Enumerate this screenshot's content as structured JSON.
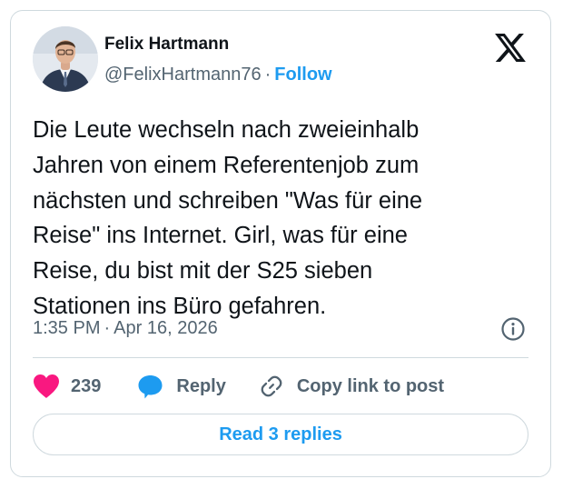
{
  "author": {
    "name": "Felix Hartmann",
    "handle": "@FelixHartmann76",
    "separator": "·",
    "follow_label": "Follow"
  },
  "tweet": {
    "text": "Die Leute wechseln nach zweieinhalb\nJahren von einem Referentenjob zum\nnächsten und schreiben \"Was für eine\nReise\" ins Internet. Girl, was für eine\nReise, du bist mit der S25 sieben\nStationen ins Büro gefahren.",
    "time": "1:35 PM",
    "separator": "·",
    "date": "Apr 16, 2026"
  },
  "actions": {
    "like_count": "239",
    "reply_label": "Reply",
    "copy_label": "Copy link to post"
  },
  "read_replies_label": "Read 3 replies",
  "icons": {
    "brand": "x-logo-icon",
    "info": "info-icon",
    "like": "heart-icon",
    "reply": "speech-bubble-icon",
    "copy": "link-icon"
  },
  "colors": {
    "accent": "#1d9bf0",
    "like": "#f91880",
    "text": "#0f1419",
    "muted": "#536471",
    "border": "#cfd9de"
  }
}
